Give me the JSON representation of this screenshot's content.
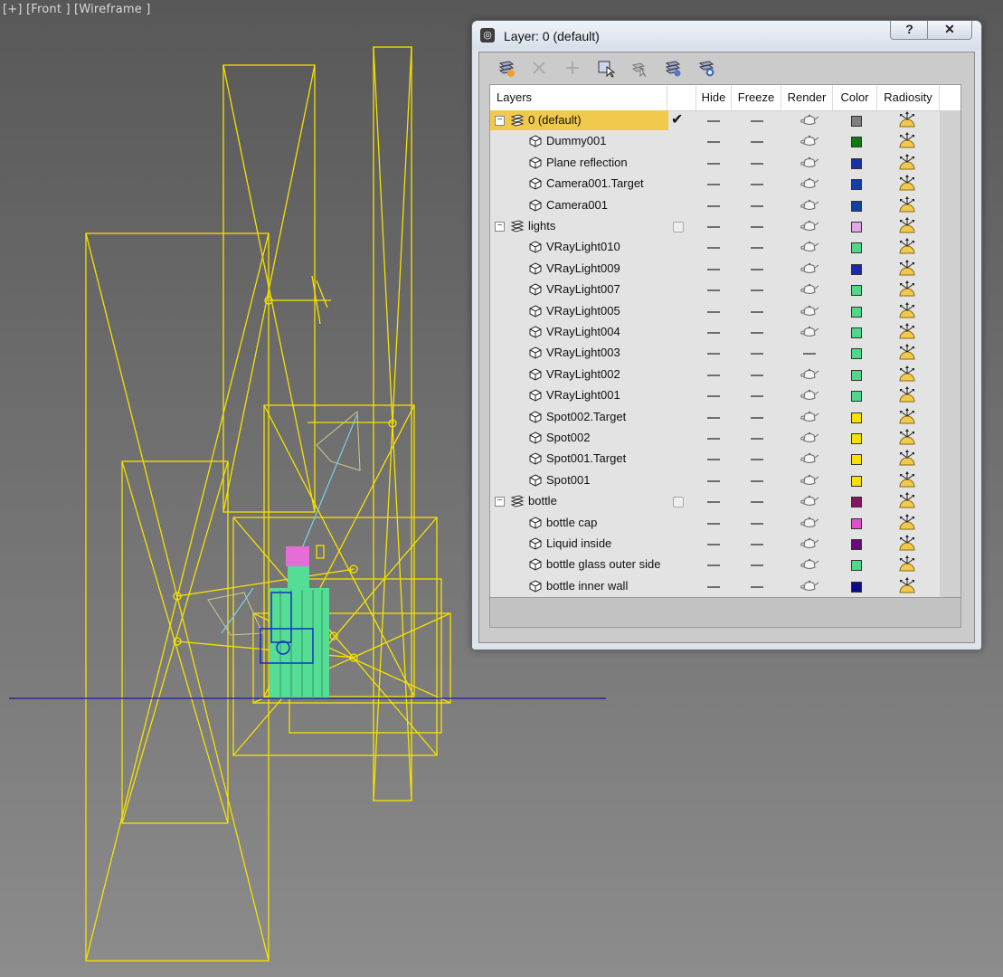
{
  "viewport": {
    "label": "[+] [Front ] [Wireframe ]",
    "wire_color": "#f6e200",
    "ground_color": "#1a1aa6"
  },
  "dialog": {
    "title": "Layer: 0 (default)",
    "help_label": "?",
    "close_label": "✕",
    "toolbar": [
      {
        "icon": "create-layer-icon"
      },
      {
        "icon": "delete-layer-icon"
      },
      {
        "icon": "add-to-layer-icon"
      },
      {
        "icon": "select-objects-icon"
      },
      {
        "icon": "highlight-layer-icon"
      },
      {
        "icon": "hide-all-icon"
      },
      {
        "icon": "freeze-all-icon"
      }
    ],
    "columns": [
      "Layers",
      "",
      "Hide",
      "Freeze",
      "Render",
      "Color",
      "Radiosity"
    ],
    "rows": [
      {
        "type": "layer",
        "name": "0 (default)",
        "current": true,
        "selected": true,
        "render": true,
        "color": "#808080"
      },
      {
        "type": "object",
        "name": "Dummy001",
        "render": true,
        "color": "#0d7a12"
      },
      {
        "type": "object",
        "name": "Plane reflection",
        "render": true,
        "color": "#1530a8"
      },
      {
        "type": "object",
        "name": "Camera001.Target",
        "render": true,
        "color": "#1240a5"
      },
      {
        "type": "object",
        "name": "Camera001",
        "render": true,
        "color": "#1240a5"
      },
      {
        "type": "layer",
        "name": "lights",
        "current": false,
        "render": true,
        "color": "#e2a8e6"
      },
      {
        "type": "object",
        "name": "VRayLight010",
        "render": true,
        "color": "#52d68a"
      },
      {
        "type": "object",
        "name": "VRayLight009",
        "render": true,
        "color": "#1a2aa8"
      },
      {
        "type": "object",
        "name": "VRayLight007",
        "render": true,
        "color": "#52d68a"
      },
      {
        "type": "object",
        "name": "VRayLight005",
        "render": true,
        "color": "#52d68a"
      },
      {
        "type": "object",
        "name": "VRayLight004",
        "render": true,
        "color": "#52d68a"
      },
      {
        "type": "object",
        "name": "VRayLight003",
        "render": false,
        "color": "#52d68a"
      },
      {
        "type": "object",
        "name": "VRayLight002",
        "render": true,
        "color": "#52d68a"
      },
      {
        "type": "object",
        "name": "VRayLight001",
        "render": true,
        "color": "#52d68a"
      },
      {
        "type": "object",
        "name": "Spot002.Target",
        "render": true,
        "color": "#f5e000"
      },
      {
        "type": "object",
        "name": "Spot002",
        "render": true,
        "color": "#f5e000"
      },
      {
        "type": "object",
        "name": "Spot001.Target",
        "render": true,
        "color": "#f5e000"
      },
      {
        "type": "object",
        "name": "Spot001",
        "render": true,
        "color": "#f5e000"
      },
      {
        "type": "layer",
        "name": "bottle",
        "current": false,
        "render": true,
        "color": "#8a1464"
      },
      {
        "type": "object",
        "name": "bottle cap",
        "render": true,
        "color": "#e050c8"
      },
      {
        "type": "object",
        "name": "Liquid inside",
        "render": true,
        "color": "#6a0a7a"
      },
      {
        "type": "object",
        "name": "bottle glass outer side",
        "render": true,
        "color": "#52d68a"
      },
      {
        "type": "object",
        "name": "bottle inner wall",
        "render": true,
        "color": "#0a0a8a"
      }
    ]
  }
}
